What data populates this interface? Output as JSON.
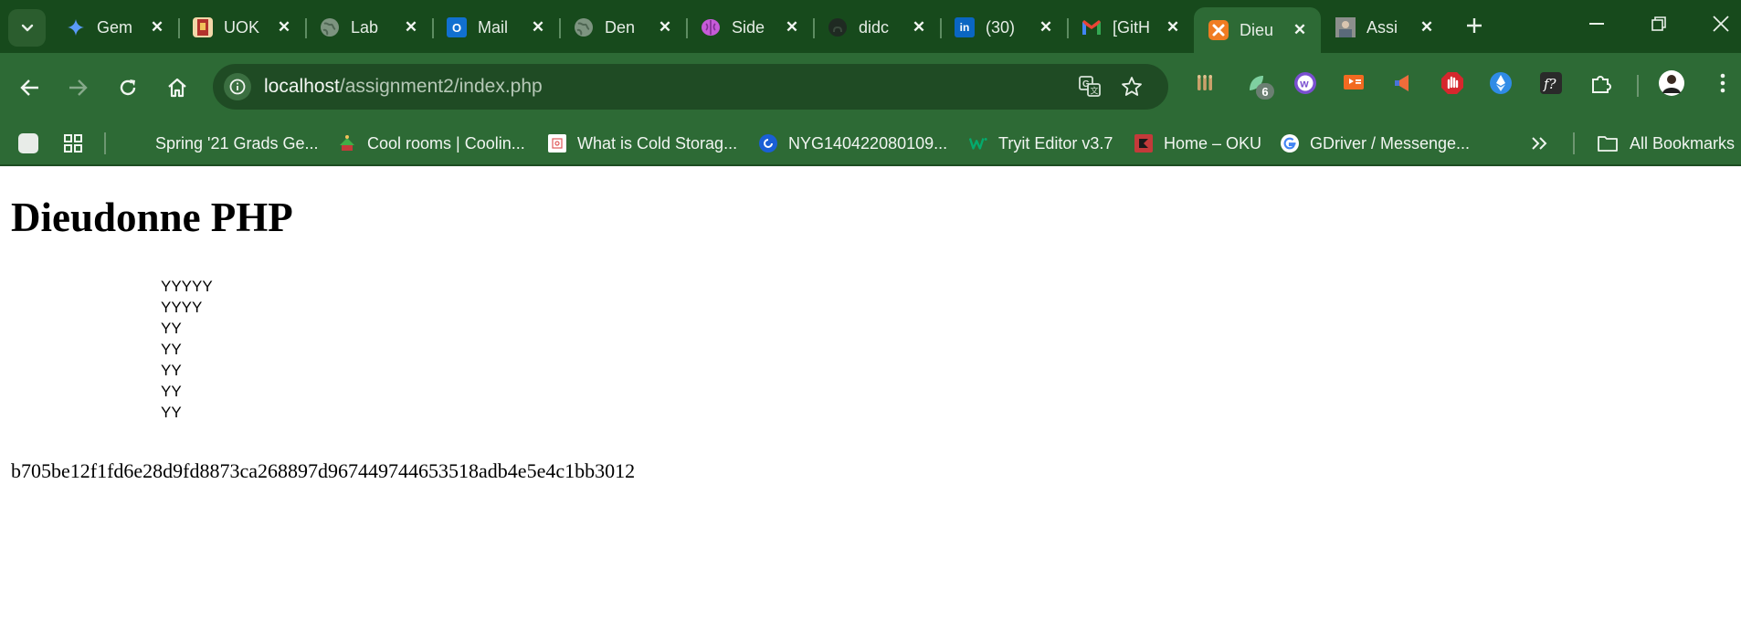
{
  "browser": {
    "tabs": [
      {
        "title": "Gem",
        "icon": "gemini-icon",
        "color": "#4a8cf7"
      },
      {
        "title": "UOK",
        "icon": "uok-logo-icon",
        "color": "#b3332d"
      },
      {
        "title": "Lab",
        "icon": "globe-icon",
        "color": "#6f8a73"
      },
      {
        "title": "Mail",
        "icon": "outlook-icon",
        "color": "#1170d0"
      },
      {
        "title": "Den",
        "icon": "globe-icon",
        "color": "#6f8a73"
      },
      {
        "title": "Side",
        "icon": "brain-icon",
        "color": "#c65bd8"
      },
      {
        "title": "didc",
        "icon": "github-icon",
        "color": "#1f2a22"
      },
      {
        "title": "(30)",
        "icon": "linkedin-icon",
        "color": "#0a66c2"
      },
      {
        "title": "[GitH",
        "icon": "gmail-icon",
        "color": "#ea4335"
      },
      {
        "title": "Dieu",
        "icon": "xampp-icon",
        "color": "#f07c22"
      },
      {
        "title": "Assi",
        "icon": "avatar-icon",
        "color": "#8a8a8a"
      }
    ],
    "url": {
      "host": "localhost",
      "path": "/assignment2/index.php"
    },
    "extension_badge": "6",
    "bookmarks": [
      {
        "label": "Spring '21 Grads Ge...",
        "icon": "none",
        "color": "#2d6a35"
      },
      {
        "label": "Cool rooms | Coolin...",
        "icon": "coolroom-icon",
        "color": "#3fae46"
      },
      {
        "label": "What is Cold Storag...",
        "icon": "page-icon",
        "color": "#ffffff"
      },
      {
        "label": "NYG140422080109...",
        "icon": "circle-icon",
        "color": "#1a5fd6"
      },
      {
        "label": "Tryit Editor v3.7",
        "icon": "w3schools-icon",
        "color": "#04aa6d"
      },
      {
        "label": "Home – OKU",
        "icon": "oku-icon",
        "color": "#c33a3a"
      },
      {
        "label": "GDriver / Messenge...",
        "icon": "google-icon",
        "color": "#ffffff"
      }
    ],
    "all_bookmarks_label": "All Bookmarks"
  },
  "page": {
    "heading": "Dieudonne PHP",
    "pattern_lines": [
      "YYYYY",
      "YYYY",
      "YY",
      "YY",
      "YY",
      "YY",
      "YY"
    ],
    "hash": "b705be12f1fd6e28d9fd8873ca268897d967449744653518adb4e5e4c1bb3012"
  }
}
